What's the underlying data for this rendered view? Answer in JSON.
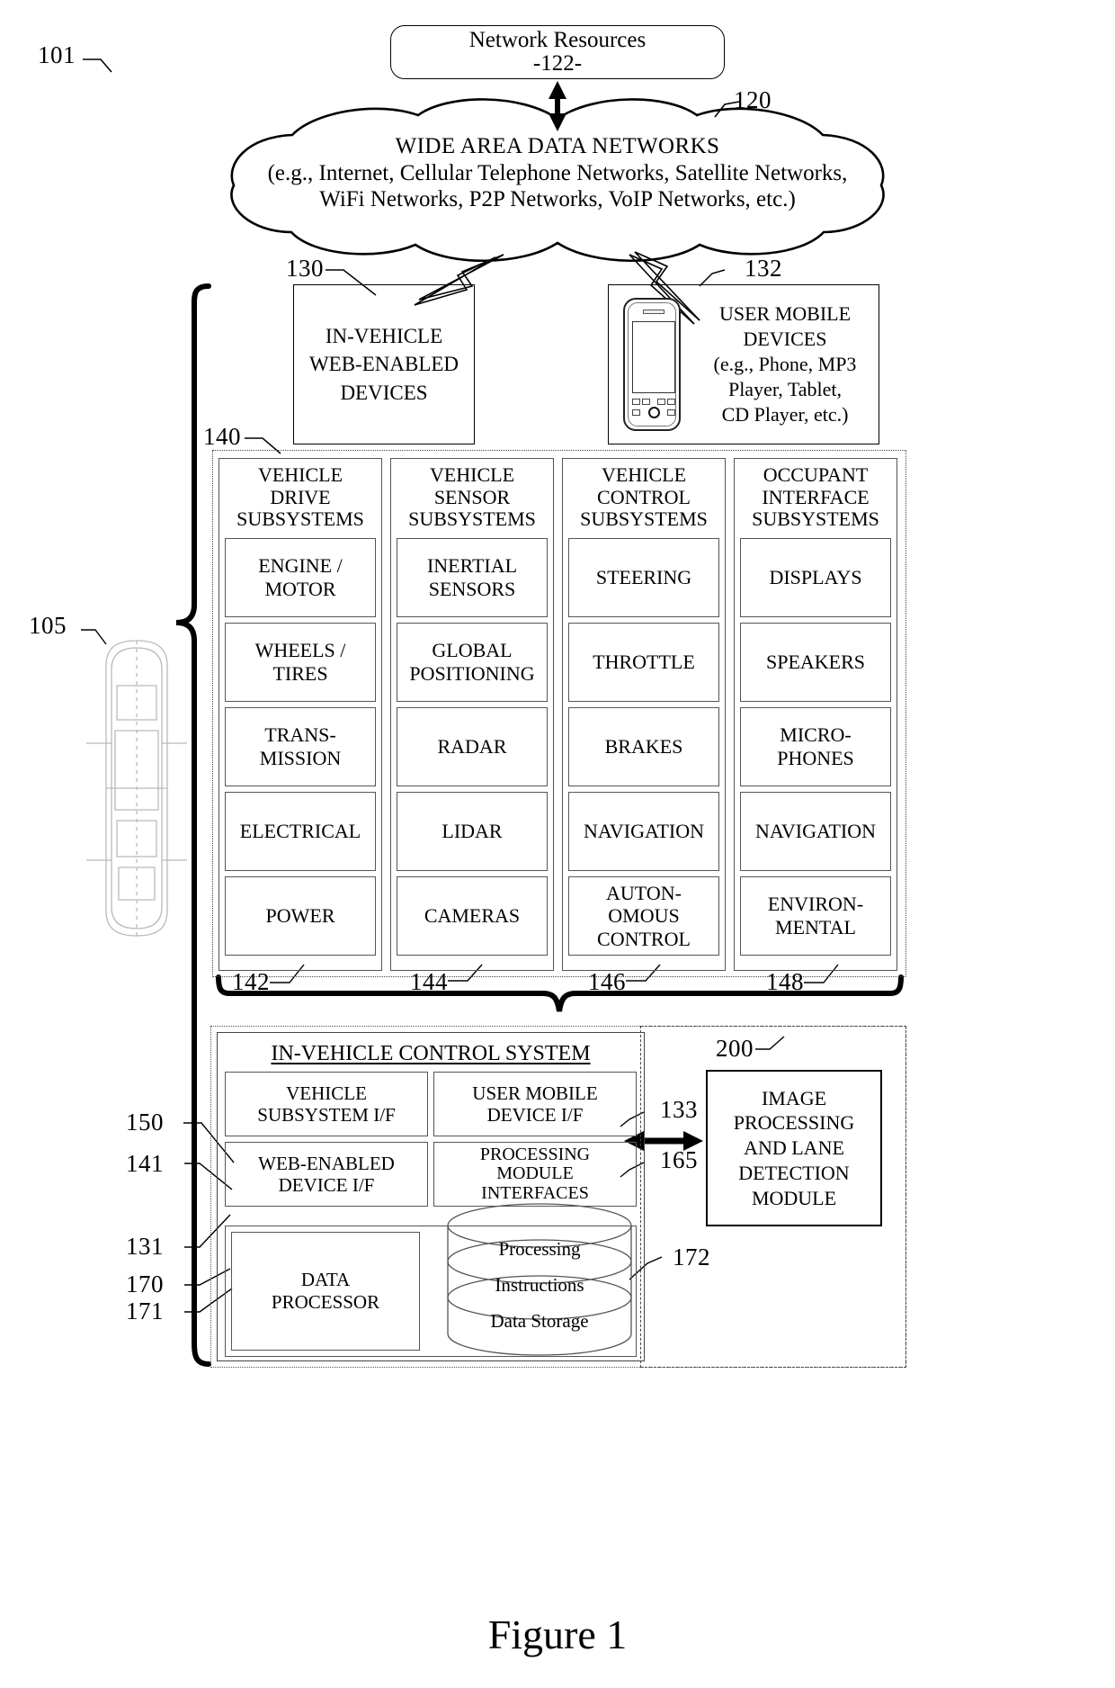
{
  "figure": {
    "caption": "Figure 1",
    "diagram_ref": "101"
  },
  "network_resources": {
    "title": "Network Resources",
    "ref": "-122-"
  },
  "cloud": {
    "title": "WIDE AREA DATA NETWORKS",
    "line2": "(e.g., Internet, Cellular Telephone Networks, Satellite Networks,",
    "line3": "WiFi Networks, P2P Networks, VoIP Networks, etc.)",
    "ref": "120"
  },
  "in_vehicle_web_devices": {
    "line1": "IN-VEHICLE",
    "line2": "WEB-ENABLED",
    "line3": "DEVICES",
    "ref": "130"
  },
  "user_mobile_devices": {
    "line1": "USER MOBILE",
    "line2": "DEVICES",
    "line3": "(e.g., Phone, MP3",
    "line4": "Player, Tablet,",
    "line5": "CD Player, etc.)",
    "ref": "132"
  },
  "vehicle": {
    "ref": "105"
  },
  "subsystems": {
    "ref": "140",
    "columns": [
      {
        "title_lines": [
          "VEHICLE",
          "DRIVE",
          "SUBSYSTEMS"
        ],
        "ref": "142",
        "items": [
          "ENGINE /\nMOTOR",
          "WHEELS /\nTIRES",
          "TRANS-\nMISSION",
          "ELECTRICAL",
          "POWER"
        ]
      },
      {
        "title_lines": [
          "VEHICLE",
          "SENSOR",
          "SUBSYSTEMS"
        ],
        "ref": "144",
        "items": [
          "INERTIAL\nSENSORS",
          "GLOBAL\nPOSITIONING",
          "RADAR",
          "LIDAR",
          "CAMERAS"
        ]
      },
      {
        "title_lines": [
          "VEHICLE",
          "CONTROL",
          "SUBSYSTEMS"
        ],
        "ref": "146",
        "items": [
          "STEERING",
          "THROTTLE",
          "BRAKES",
          "NAVIGATION",
          "AUTON-\nOMOUS\nCONTROL"
        ]
      },
      {
        "title_lines": [
          "OCCUPANT",
          "INTERFACE",
          "SUBSYSTEMS"
        ],
        "ref": "148",
        "items": [
          "DISPLAYS",
          "SPEAKERS",
          "MICRO-\nPHONES",
          "NAVIGATION",
          "ENVIRON-\nMENTAL"
        ]
      }
    ]
  },
  "control_system": {
    "title": "IN-VEHICLE CONTROL SYSTEM",
    "ref_outer": "150",
    "ref_title": "141",
    "cells": {
      "vehicle_subsystem_if": "VEHICLE\nSUBSYSTEM I/F",
      "user_mobile_device_if": "USER MOBILE\nDEVICE I/F",
      "web_enabled_device_if": "WEB-ENABLED\nDEVICE I/F",
      "processing_module_interfaces": "PROCESSING\nMODULE\nINTERFACES",
      "data_processor": "DATA\nPROCESSOR"
    },
    "refs": {
      "vehicle_subsystem_if": "131",
      "user_mobile_device_if": "133",
      "web_enabled_device_if": "170",
      "processing_module_interfaces": "165",
      "data_processor": "171",
      "storage": "172"
    },
    "storage": {
      "line1": "Processing",
      "line2": "Instructions",
      "line3": "Data Storage"
    }
  },
  "image_processing_module": {
    "ref": "200",
    "line1": "IMAGE",
    "line2": "PROCESSING",
    "line3": "AND LANE",
    "line4": "DETECTION",
    "line5": "MODULE"
  },
  "colors": {
    "line": "#000000",
    "faint_line": "#555555",
    "background": "#ffffff"
  }
}
